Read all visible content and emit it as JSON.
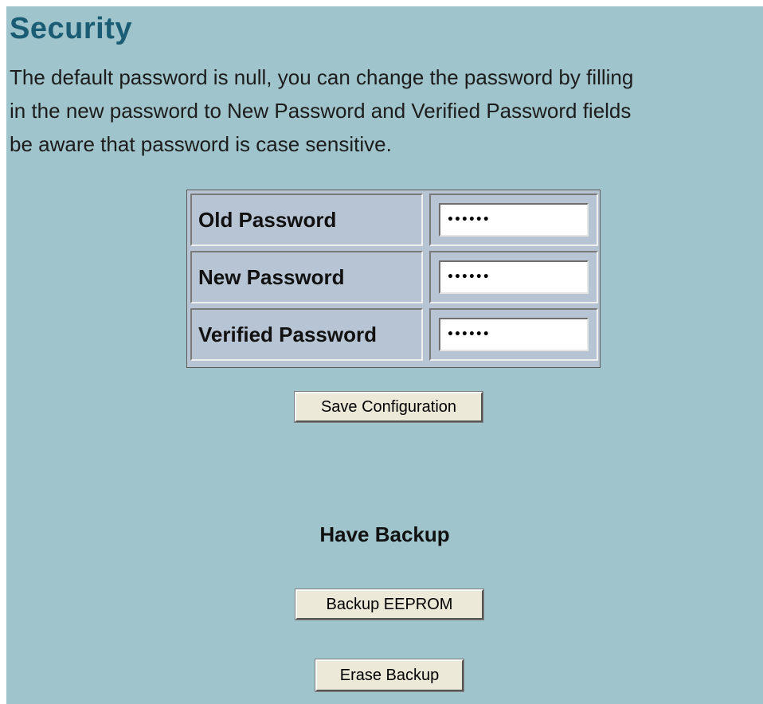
{
  "page": {
    "title": "Security",
    "description_lines": [
      "The default password is null, you can change the password by filling",
      "in the new password to New Password and Verified Password fields",
      "be aware that password is case sensitive."
    ]
  },
  "password_form": {
    "rows": [
      {
        "label": "Old Password",
        "value": "••••••"
      },
      {
        "label": "New Password",
        "value": "••••••"
      },
      {
        "label": "Verified Password",
        "value": "••••••"
      }
    ],
    "save_button_label": "Save Configuration"
  },
  "backup": {
    "heading": "Have Backup",
    "backup_button_label": "Backup EEPROM",
    "erase_button_label": "Erase Backup"
  },
  "colors": {
    "panel_background": "#a0c4cc",
    "title_color": "#1a5c74",
    "table_background": "#b7c4d3",
    "button_face": "#ece9d8"
  }
}
